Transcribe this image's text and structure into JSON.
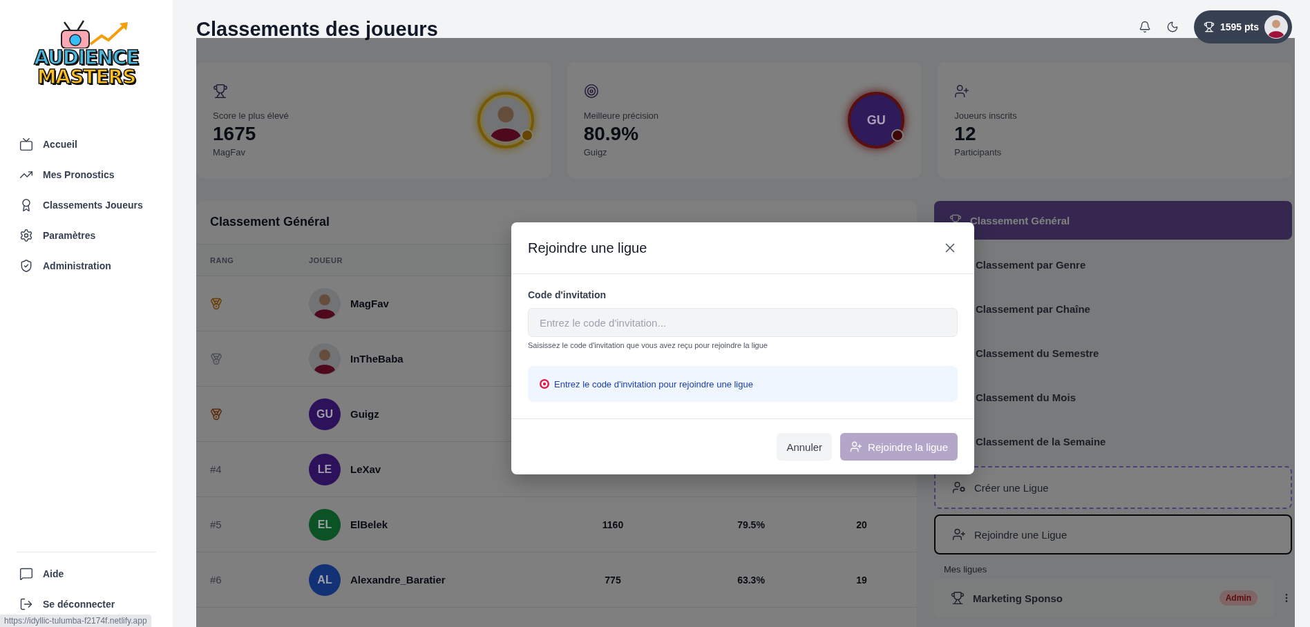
{
  "sidebar": {
    "logo": {
      "line_1": "AUDIENCE",
      "line_2": "MASTERS"
    },
    "nav": [
      {
        "label": "Accueil"
      },
      {
        "label": "Mes Pronostics"
      },
      {
        "label": "Classements Joueurs"
      },
      {
        "label": "Paramètres"
      },
      {
        "label": "Administration"
      }
    ],
    "footer": [
      {
        "label": "Aide"
      },
      {
        "label": "Se déconnecter"
      }
    ]
  },
  "status_url": "https://idyllic-tulumba-f2174f.netlify.app",
  "header": {
    "title": "Classements des joueurs",
    "points": "1595 pts"
  },
  "stats": [
    {
      "label": "Score le plus élevé",
      "value": "1675",
      "sub": "MagFav"
    },
    {
      "label": "Meilleure précision",
      "value": "80.9%",
      "sub": "Guigz",
      "avatar": {
        "kind": "initials",
        "initials": "GU",
        "color": "#2f1a5a"
      }
    },
    {
      "label": "Joueurs inscrits",
      "value": "12",
      "sub": "Participants"
    }
  ],
  "table": {
    "title": "Classement Général",
    "columns": [
      "RANG",
      "JOUEUR"
    ],
    "rows": [
      {
        "rank": {
          "kind": "medal",
          "color": "#6c3b03"
        },
        "name": "MagFav"
      },
      {
        "rank": {
          "kind": "medal",
          "color": "#4e5258"
        },
        "name": "InTheBaba"
      },
      {
        "rank": {
          "kind": "medal",
          "color": "#5a2a05"
        },
        "avatar": {
          "kind": "initials",
          "initials": "GU",
          "color": "#2e115b"
        },
        "name": "Guigz"
      },
      {
        "rank": {
          "kind": "text",
          "text": "#4"
        },
        "avatar": {
          "kind": "initials",
          "initials": "LE",
          "color": "#2e115b"
        },
        "name": "LeXav"
      },
      {
        "rank": {
          "kind": "text",
          "text": "#5"
        },
        "avatar": {
          "kind": "initials",
          "initials": "EL",
          "color": "#0b5225"
        },
        "name": "ElBelek",
        "cells": [
          "1160",
          "79.5%",
          "20"
        ]
      },
      {
        "rank": {
          "kind": "text",
          "text": "#6"
        },
        "avatar": {
          "kind": "initials",
          "initials": "AL",
          "color": "#133276"
        },
        "name": "Alexandre_Baratier",
        "cells": [
          "775",
          "63.3%",
          "19"
        ]
      }
    ]
  },
  "leaderboards": [
    {
      "label": "Classement Général",
      "selected": true
    },
    {
      "label": "Classement par Genre",
      "selected": false
    },
    {
      "label": "Classement par Chaîne",
      "selected": false
    },
    {
      "label": "Classement du Semestre",
      "selected": false
    },
    {
      "label": "Classement du Mois",
      "selected": false
    },
    {
      "label": "Classement de la Semaine",
      "selected": false
    }
  ],
  "league_actions": [
    {
      "kind": "create",
      "label": "Créer une Ligue"
    },
    {
      "kind": "join",
      "label": "Rejoindre une Ligue"
    }
  ],
  "my_leagues": {
    "title": "Mes ligues",
    "items": [
      {
        "name": "Marketing Sponso",
        "badge": "Admin"
      }
    ]
  },
  "modal": {
    "title": "Rejoindre une ligue",
    "field_label": "Code d'invitation",
    "placeholder": "Entrez le code d'invitation...",
    "help": "Saisissez le code d'invitation que vous avez reçu pour rejoindre la ligue",
    "info": "Entrez le code d'invitation pour rejoindre une ligue",
    "buttons": [
      {
        "kind": "cancel",
        "label": "Annuler"
      },
      {
        "kind": "submit",
        "label": "Rejoindre la ligue",
        "disabled": true
      }
    ]
  }
}
